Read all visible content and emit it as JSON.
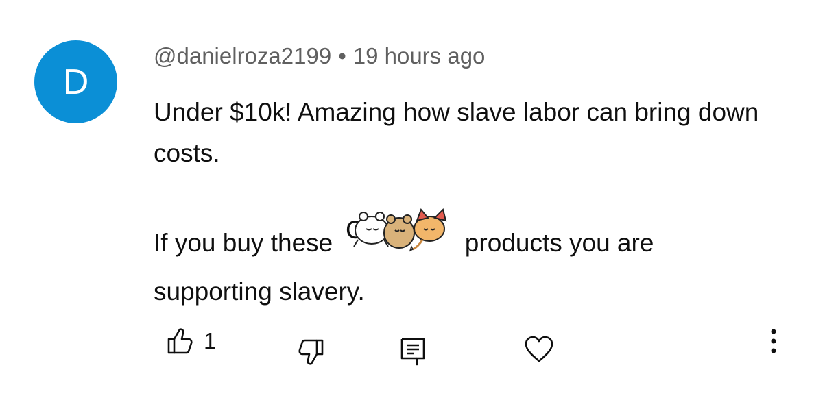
{
  "comment": {
    "avatar_letter": "D",
    "author": "@danielroza2199",
    "separator": "•",
    "time": "19 hours ago",
    "paragraph1": "Under $10k!  Amazing how slave labor can bring down costs.",
    "paragraph2_before": "If you buy these",
    "paragraph2_after": "products you are supporting slavery.",
    "sticker": {
      "icon": "cute-animals-sticker-icon",
      "occluded_text_partial": "C"
    }
  },
  "actions": {
    "like_count": "1",
    "like_icon": "thumbs-up-icon",
    "dislike_icon": "thumbs-down-icon",
    "reply_icon": "reply-comment-icon",
    "heart_icon": "heart-icon",
    "more_icon": "more-vertical-icon"
  },
  "colors": {
    "avatar": "#0b8fd6",
    "meta_text": "#606060",
    "body_text": "#0f0f0f"
  }
}
